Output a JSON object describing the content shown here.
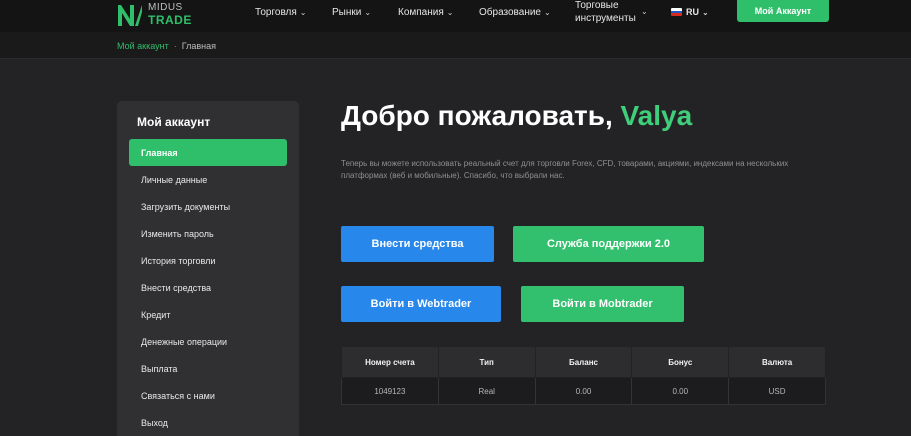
{
  "header": {
    "logo": {
      "line1": "MIDUS",
      "line2": "TRADE"
    },
    "nav": [
      {
        "label": "Торговля"
      },
      {
        "label": "Рынки"
      },
      {
        "label": "Компания"
      },
      {
        "label": "Образование"
      },
      {
        "label": "Торговые инструменты"
      }
    ],
    "language": "RU",
    "account_button": "Мой Аккаунт"
  },
  "breadcrumb": {
    "parent": "Мой аккаунт",
    "separator": "·",
    "current": "Главная"
  },
  "sidebar": {
    "title": "Мой аккаунт",
    "items": [
      {
        "label": "Главная",
        "active": true
      },
      {
        "label": "Личные данные"
      },
      {
        "label": "Загрузить документы"
      },
      {
        "label": "Изменить пароль"
      },
      {
        "label": "История торговли"
      },
      {
        "label": "Внести средства"
      },
      {
        "label": "Кредит"
      },
      {
        "label": "Денежные операции"
      },
      {
        "label": "Выплата"
      },
      {
        "label": "Связаться с нами"
      },
      {
        "label": "Выход"
      }
    ]
  },
  "main": {
    "greeting": "Добро пожаловать,",
    "user_name": "Valya",
    "subtext": "Теперь вы можете использовать реальный счет для торговли Forex, CFD, товарами, акциями, индексами на нескольких платформах (веб и мобильные). Спасибо, что выбрали нас.",
    "buttons": {
      "deposit": "Внести средства",
      "support": "Служба поддержки 2.0",
      "webtrader": "Войти в Webtrader",
      "mobtrader": "Войти в Mobtrader"
    }
  },
  "account_table": {
    "columns": [
      "Номер счета",
      "Тип",
      "Баланс",
      "Бонус",
      "Валюта"
    ],
    "rows": [
      [
        "1049123",
        "Real",
        "0.00",
        "0.00",
        "USD"
      ]
    ]
  },
  "colors": {
    "accent_green": "#2fbf6b",
    "accent_blue": "#2787ea",
    "background": "#232325",
    "header_bg": "#141414"
  },
  "icons": {
    "logo": "midus-logo-icon",
    "nav_dropdown": "chevron-down-icon",
    "language_flag": "russia-flag-icon"
  }
}
